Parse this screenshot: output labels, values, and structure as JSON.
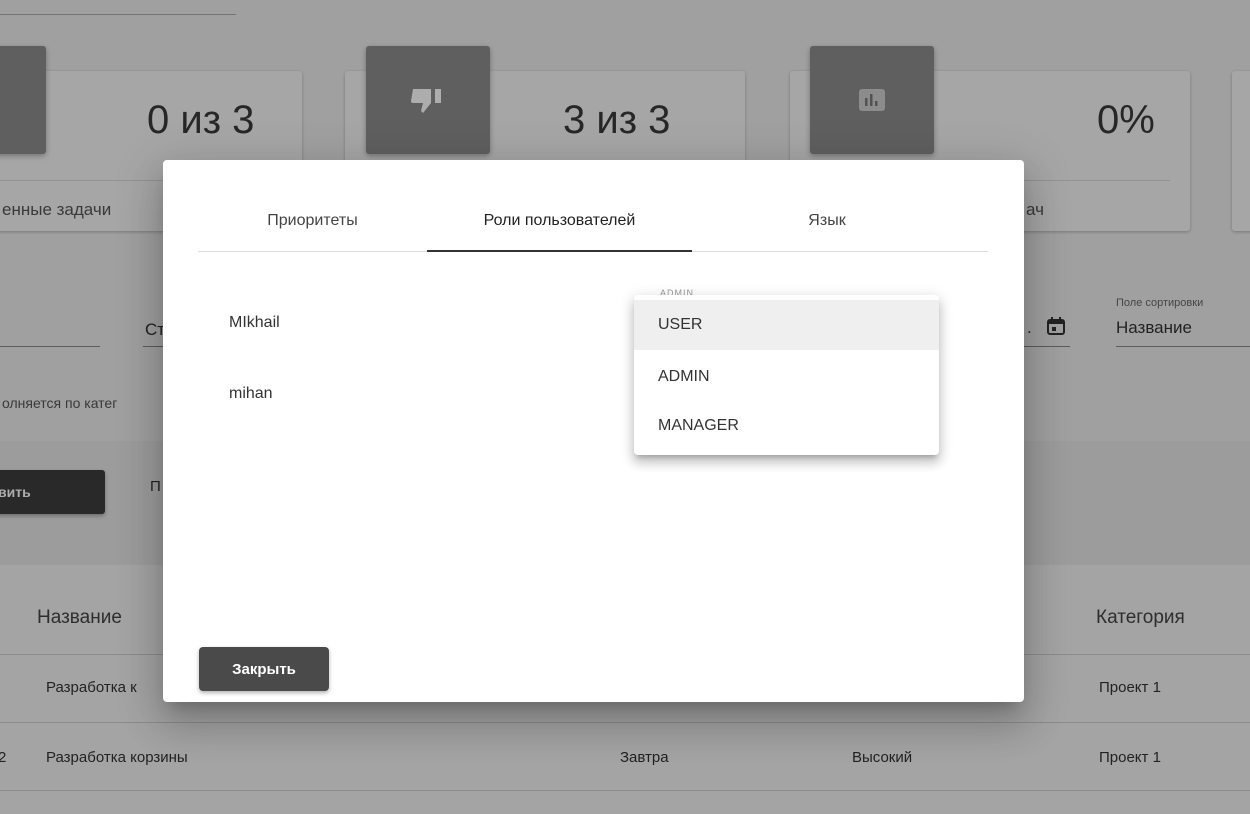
{
  "stats": {
    "card1": {
      "value": "0 из 3",
      "label": "енные задачи"
    },
    "card2": {
      "value": "3 из 3"
    },
    "card3": {
      "value": "0%",
      "label": "ач"
    }
  },
  "filters": {
    "status_prefix": "Ст",
    "category_hint": "олняется по катег",
    "sort_label": "Поле сортировки",
    "sort_value": "Название",
    "date_dot": "."
  },
  "toolbar": {
    "add_label": "вить",
    "other_prefix": "П"
  },
  "table": {
    "headers": {
      "name": "Название",
      "category": "Категория"
    },
    "rows": [
      {
        "num": "",
        "name": "Разработка к",
        "date": "",
        "priority": "",
        "category": "Проект 1"
      },
      {
        "num": "2",
        "name": "Разработка корзины",
        "date": "Завтра",
        "priority": "Высокий",
        "category": "Проект 1"
      }
    ]
  },
  "dialog": {
    "tabs": [
      "Приоритеты",
      "Роли пользователей",
      "Язык"
    ],
    "active_tab_index": 1,
    "users": [
      "MIkhail",
      "mihan"
    ],
    "ghost_select_value": "ADMIN",
    "role_options": [
      "USER",
      "ADMIN",
      "MANAGER"
    ],
    "highlighted_option": "USER",
    "close_label": "Закрыть"
  }
}
